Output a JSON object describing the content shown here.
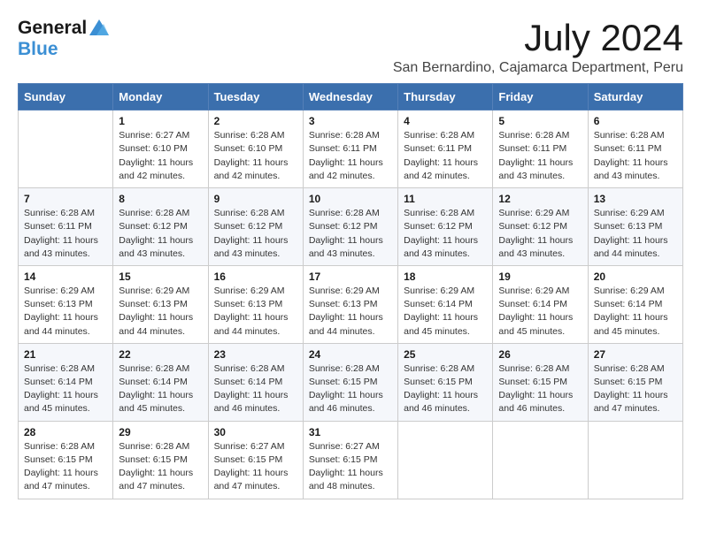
{
  "logo": {
    "general": "General",
    "blue": "Blue"
  },
  "title": "July 2024",
  "subtitle": "San Bernardino, Cajamarca Department, Peru",
  "days_of_week": [
    "Sunday",
    "Monday",
    "Tuesday",
    "Wednesday",
    "Thursday",
    "Friday",
    "Saturday"
  ],
  "weeks": [
    [
      {
        "day": "",
        "detail": ""
      },
      {
        "day": "1",
        "detail": "Sunrise: 6:27 AM\nSunset: 6:10 PM\nDaylight: 11 hours\nand 42 minutes."
      },
      {
        "day": "2",
        "detail": "Sunrise: 6:28 AM\nSunset: 6:10 PM\nDaylight: 11 hours\nand 42 minutes."
      },
      {
        "day": "3",
        "detail": "Sunrise: 6:28 AM\nSunset: 6:11 PM\nDaylight: 11 hours\nand 42 minutes."
      },
      {
        "day": "4",
        "detail": "Sunrise: 6:28 AM\nSunset: 6:11 PM\nDaylight: 11 hours\nand 42 minutes."
      },
      {
        "day": "5",
        "detail": "Sunrise: 6:28 AM\nSunset: 6:11 PM\nDaylight: 11 hours\nand 43 minutes."
      },
      {
        "day": "6",
        "detail": "Sunrise: 6:28 AM\nSunset: 6:11 PM\nDaylight: 11 hours\nand 43 minutes."
      }
    ],
    [
      {
        "day": "7",
        "detail": "Sunrise: 6:28 AM\nSunset: 6:11 PM\nDaylight: 11 hours\nand 43 minutes."
      },
      {
        "day": "8",
        "detail": "Sunrise: 6:28 AM\nSunset: 6:12 PM\nDaylight: 11 hours\nand 43 minutes."
      },
      {
        "day": "9",
        "detail": "Sunrise: 6:28 AM\nSunset: 6:12 PM\nDaylight: 11 hours\nand 43 minutes."
      },
      {
        "day": "10",
        "detail": "Sunrise: 6:28 AM\nSunset: 6:12 PM\nDaylight: 11 hours\nand 43 minutes."
      },
      {
        "day": "11",
        "detail": "Sunrise: 6:28 AM\nSunset: 6:12 PM\nDaylight: 11 hours\nand 43 minutes."
      },
      {
        "day": "12",
        "detail": "Sunrise: 6:29 AM\nSunset: 6:12 PM\nDaylight: 11 hours\nand 43 minutes."
      },
      {
        "day": "13",
        "detail": "Sunrise: 6:29 AM\nSunset: 6:13 PM\nDaylight: 11 hours\nand 44 minutes."
      }
    ],
    [
      {
        "day": "14",
        "detail": "Sunrise: 6:29 AM\nSunset: 6:13 PM\nDaylight: 11 hours\nand 44 minutes."
      },
      {
        "day": "15",
        "detail": "Sunrise: 6:29 AM\nSunset: 6:13 PM\nDaylight: 11 hours\nand 44 minutes."
      },
      {
        "day": "16",
        "detail": "Sunrise: 6:29 AM\nSunset: 6:13 PM\nDaylight: 11 hours\nand 44 minutes."
      },
      {
        "day": "17",
        "detail": "Sunrise: 6:29 AM\nSunset: 6:13 PM\nDaylight: 11 hours\nand 44 minutes."
      },
      {
        "day": "18",
        "detail": "Sunrise: 6:29 AM\nSunset: 6:14 PM\nDaylight: 11 hours\nand 45 minutes."
      },
      {
        "day": "19",
        "detail": "Sunrise: 6:29 AM\nSunset: 6:14 PM\nDaylight: 11 hours\nand 45 minutes."
      },
      {
        "day": "20",
        "detail": "Sunrise: 6:29 AM\nSunset: 6:14 PM\nDaylight: 11 hours\nand 45 minutes."
      }
    ],
    [
      {
        "day": "21",
        "detail": "Sunrise: 6:28 AM\nSunset: 6:14 PM\nDaylight: 11 hours\nand 45 minutes."
      },
      {
        "day": "22",
        "detail": "Sunrise: 6:28 AM\nSunset: 6:14 PM\nDaylight: 11 hours\nand 45 minutes."
      },
      {
        "day": "23",
        "detail": "Sunrise: 6:28 AM\nSunset: 6:14 PM\nDaylight: 11 hours\nand 46 minutes."
      },
      {
        "day": "24",
        "detail": "Sunrise: 6:28 AM\nSunset: 6:15 PM\nDaylight: 11 hours\nand 46 minutes."
      },
      {
        "day": "25",
        "detail": "Sunrise: 6:28 AM\nSunset: 6:15 PM\nDaylight: 11 hours\nand 46 minutes."
      },
      {
        "day": "26",
        "detail": "Sunrise: 6:28 AM\nSunset: 6:15 PM\nDaylight: 11 hours\nand 46 minutes."
      },
      {
        "day": "27",
        "detail": "Sunrise: 6:28 AM\nSunset: 6:15 PM\nDaylight: 11 hours\nand 47 minutes."
      }
    ],
    [
      {
        "day": "28",
        "detail": "Sunrise: 6:28 AM\nSunset: 6:15 PM\nDaylight: 11 hours\nand 47 minutes."
      },
      {
        "day": "29",
        "detail": "Sunrise: 6:28 AM\nSunset: 6:15 PM\nDaylight: 11 hours\nand 47 minutes."
      },
      {
        "day": "30",
        "detail": "Sunrise: 6:27 AM\nSunset: 6:15 PM\nDaylight: 11 hours\nand 47 minutes."
      },
      {
        "day": "31",
        "detail": "Sunrise: 6:27 AM\nSunset: 6:15 PM\nDaylight: 11 hours\nand 48 minutes."
      },
      {
        "day": "",
        "detail": ""
      },
      {
        "day": "",
        "detail": ""
      },
      {
        "day": "",
        "detail": ""
      }
    ]
  ]
}
